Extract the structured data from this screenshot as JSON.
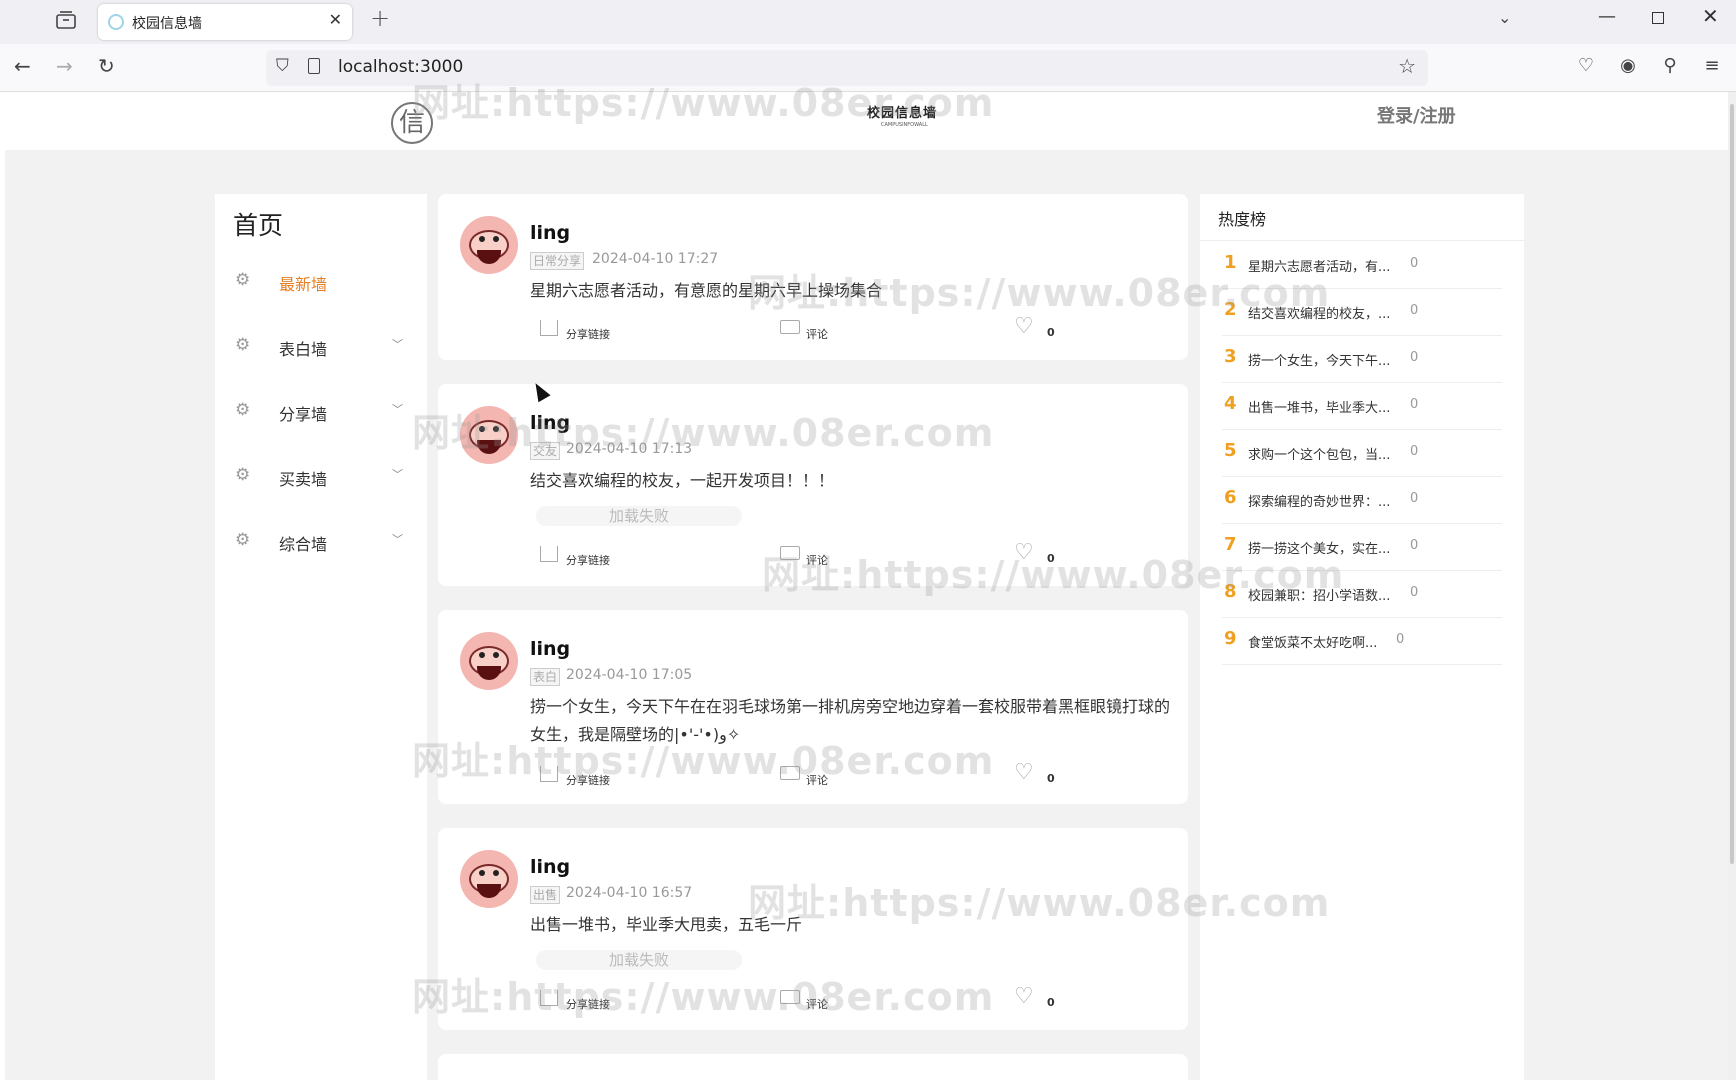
{
  "browser": {
    "tab_title": "校园信息墙",
    "tab_close": "✕",
    "new_tab": "+",
    "url": "localhost:3000"
  },
  "site": {
    "logo_char": "信",
    "brand": "校园信息墙",
    "brand_sub": "CAMPUSINFOWALL",
    "login": "登录/注册"
  },
  "sidebar": {
    "title": "首页",
    "items": [
      {
        "label": "最新墙",
        "active": true
      },
      {
        "label": "表白墙",
        "has_submenu": true
      },
      {
        "label": "分享墙",
        "has_submenu": true
      },
      {
        "label": "买卖墙",
        "has_submenu": true
      },
      {
        "label": "综合墙",
        "has_submenu": true
      }
    ]
  },
  "actions": {
    "share": "分享链接",
    "comment": "评论"
  },
  "posts": [
    {
      "user": "ling",
      "tag": "日常分享",
      "time": "2024-04-10 17:27",
      "content": "星期六志愿者活动，有意愿的星期六早上操场集合",
      "likes": "0"
    },
    {
      "user": "ling",
      "tag": "交友",
      "time": "2024-04-10 17:13",
      "content": "结交喜欢编程的校友，一起开发项目！！！",
      "image_text": "加载失败",
      "likes": "0"
    },
    {
      "user": "ling",
      "tag": "表白",
      "time": "2024-04-10 17:05",
      "content": "捞一个女生，今天下午在在羽毛球场第一排机房旁空地边穿着一套校服带着黑框眼镜打球的女生，我是隔壁场的|•'-'•)و✧",
      "likes": "0"
    },
    {
      "user": "ling",
      "tag": "出售",
      "time": "2024-04-10 16:57",
      "content": "出售一堆书，毕业季大甩卖，五毛一斤",
      "image_text": "加载失败",
      "likes": "0"
    }
  ],
  "hot": {
    "title": "热度榜",
    "items": [
      {
        "rank": "1",
        "text": "星期六志愿者活动，有...",
        "count": "0"
      },
      {
        "rank": "2",
        "text": "结交喜欢编程的校友，...",
        "count": "0"
      },
      {
        "rank": "3",
        "text": "捞一个女生，今天下午...",
        "count": "0"
      },
      {
        "rank": "4",
        "text": "出售一堆书，毕业季大...",
        "count": "0"
      },
      {
        "rank": "5",
        "text": "求购一个这个包包，当...",
        "count": "0"
      },
      {
        "rank": "6",
        "text": "探索编程的奇妙世界：...",
        "count": "0"
      },
      {
        "rank": "7",
        "text": "捞一捞这个美女，实在...",
        "count": "0"
      },
      {
        "rank": "8",
        "text": "校园兼职：招小学语数...",
        "count": "0"
      },
      {
        "rank": "9",
        "text": "食堂饭菜不太好吃啊...",
        "count": "0"
      }
    ]
  },
  "watermark": "网址:https://www.08er.com",
  "colors": {
    "accent": "#e67e22",
    "hot_rank": "#f0a020"
  }
}
